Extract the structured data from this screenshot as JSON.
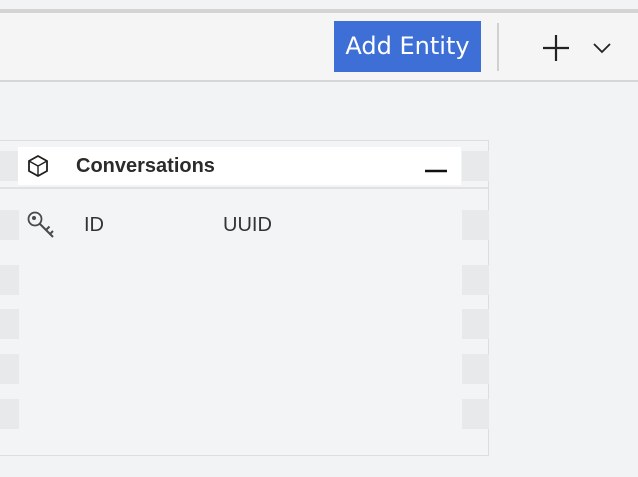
{
  "toolbar": {
    "add_entity_label": "Add Entity",
    "add_icon": "plus-icon",
    "dropdown_icon": "chevron-down-icon",
    "accent_color": "#3d6fd6"
  },
  "entity": {
    "icon": "cube-icon",
    "title": "Conversations",
    "collapse_icon": "minus-icon",
    "fields": [
      {
        "icon": "key-icon",
        "name": "ID",
        "type": "UUID"
      }
    ]
  }
}
